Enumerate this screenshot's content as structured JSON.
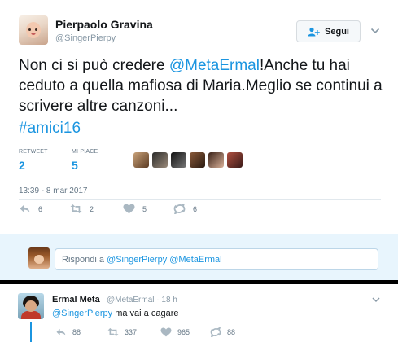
{
  "tweet": {
    "author_name": "Pierpaolo Gravina",
    "author_handle": "@SingerPierpy",
    "follow_label": "Segui",
    "text_before": "Non ci si può credere ",
    "mention": "@MetaErmal",
    "text_after": "!Anche tu hai ceduto a quella mafiosa di Maria.Meglio se continui a scrivere altre canzoni...",
    "hashtag": "#amici16",
    "stats": {
      "retweet_label": "RETWEET",
      "retweet_count": "2",
      "likes_label": "MI PIACE",
      "likes_count": "5"
    },
    "timestamp": "13:39 - 8 mar 2017",
    "actions": {
      "reply_count": "6",
      "retweet_count": "2",
      "like_count": "5",
      "dm_count": "6"
    }
  },
  "reply_box": {
    "prefix": "Rispondi a ",
    "mentions": "@SingerPierpy @MetaErmal"
  },
  "reply_tweet": {
    "author_name": "Ermal Meta",
    "meta": "@MetaErmal · 18 h",
    "mention": "@SingerPierpy",
    "text": " ma vai a cagare",
    "actions": {
      "reply_count": "88",
      "retweet_count": "337",
      "like_count": "965",
      "dm_count": "88"
    }
  },
  "colors": {
    "link": "#1b95e0",
    "text": "#14171a",
    "muted": "#657786",
    "reply_panel_bg": "#e8f5fd"
  }
}
